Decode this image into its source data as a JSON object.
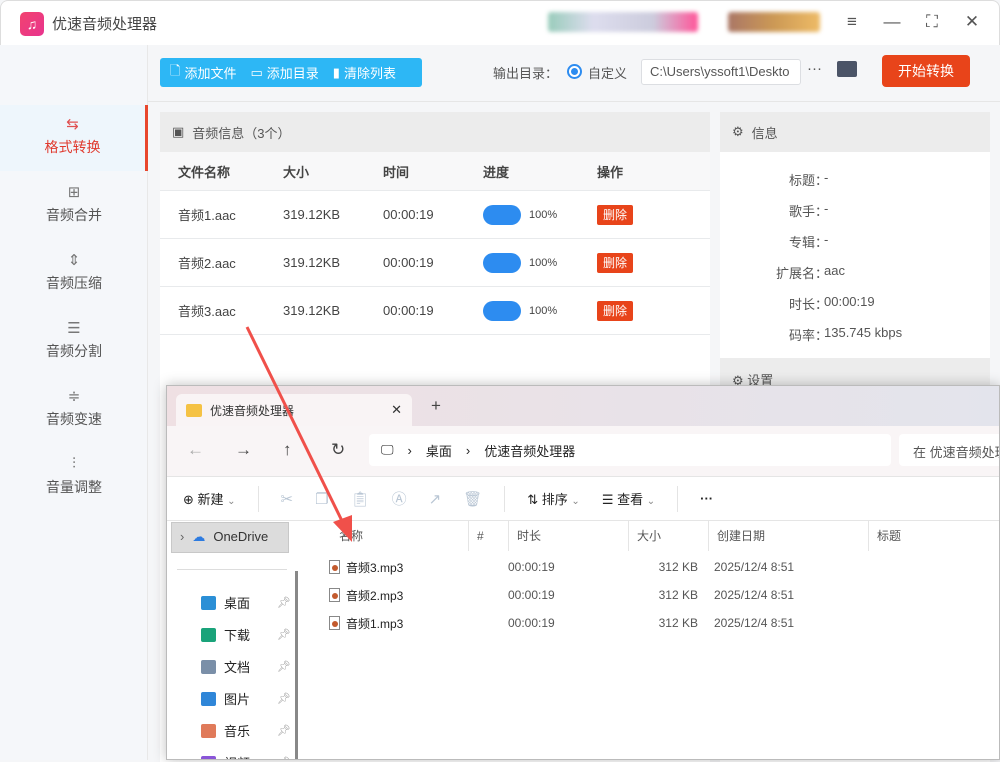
{
  "app": {
    "title": "优速音频处理器",
    "colors": {
      "accent": "#2db7f5",
      "danger": "#e8441a",
      "progress": "#2d8cf0"
    }
  },
  "window_controls": [
    "menu-icon",
    "minimize-icon",
    "maximize-icon",
    "close-icon"
  ],
  "sidebar": {
    "items": [
      {
        "label": "格式转换",
        "icon": "convert-icon",
        "selected": true
      },
      {
        "label": "音频合并",
        "icon": "merge-icon"
      },
      {
        "label": "音频压缩",
        "icon": "compress-icon"
      },
      {
        "label": "音频分割",
        "icon": "split-icon"
      },
      {
        "label": "音频变速",
        "icon": "speed-icon"
      },
      {
        "label": "音量调整",
        "icon": "volume-icon"
      }
    ]
  },
  "toolbar": {
    "add_file": "添加文件",
    "add_dir": "添加目录",
    "clear_list": "清除列表",
    "output_label": "输出目录：",
    "custom_label": "自定义",
    "output_path": "C:\\Users\\yssoft1\\Deskto",
    "more": "···",
    "start": "开始转换"
  },
  "file_panel": {
    "title": "音频信息（3个）",
    "headers": [
      "文件名称",
      "大小",
      "时间",
      "进度",
      "操作"
    ],
    "rows": [
      {
        "name": "音频1.aac",
        "size": "319.12KB",
        "time": "00:00:19",
        "progress": "100%",
        "action": "删除"
      },
      {
        "name": "音频2.aac",
        "size": "319.12KB",
        "time": "00:00:19",
        "progress": "100%",
        "action": "删除"
      },
      {
        "name": "音频3.aac",
        "size": "319.12KB",
        "time": "00:00:19",
        "progress": "100%",
        "action": "删除"
      }
    ]
  },
  "info_panel": {
    "title": "信息",
    "fields": [
      {
        "k": "标题：",
        "v": "-"
      },
      {
        "k": "歌手：",
        "v": "-"
      },
      {
        "k": "专辑：",
        "v": "-"
      },
      {
        "k": "扩展名：",
        "v": "aac"
      },
      {
        "k": "时长：",
        "v": "00:00:19"
      },
      {
        "k": "码率：",
        "v": "135.745 kbps"
      }
    ],
    "settings_title": "设置"
  },
  "explorer": {
    "tab_title": "优速音频处理器",
    "new_tab": "+",
    "breadcrumb": [
      "桌面",
      "优速音频处理器"
    ],
    "search_placeholder": "在 优速音频处理器中搜索",
    "commands": {
      "new": "新建",
      "sort": "排序",
      "view": "查看",
      "more": "···"
    },
    "nav": [
      {
        "label": "OneDrive"
      },
      {
        "label": "桌面",
        "color": "#2b8fd6"
      },
      {
        "label": "下载",
        "color": "#1aa37a"
      },
      {
        "label": "文档",
        "color": "#7a8fa8"
      },
      {
        "label": "图片",
        "color": "#2f86d8"
      },
      {
        "label": "音乐",
        "color": "#e07a5a"
      },
      {
        "label": "视频",
        "color": "#8a55d8"
      }
    ],
    "columns": [
      "名称",
      "#",
      "时长",
      "大小",
      "创建日期",
      "标题"
    ],
    "files": [
      {
        "name": "音频3.mp3",
        "duration": "00:00:19",
        "size": "312 KB",
        "created": "2025/12/4 8:51"
      },
      {
        "name": "音频2.mp3",
        "duration": "00:00:19",
        "size": "312 KB",
        "created": "2025/12/4 8:51"
      },
      {
        "name": "音频1.mp3",
        "duration": "00:00:19",
        "size": "312 KB",
        "created": "2025/12/4 8:51"
      }
    ]
  }
}
